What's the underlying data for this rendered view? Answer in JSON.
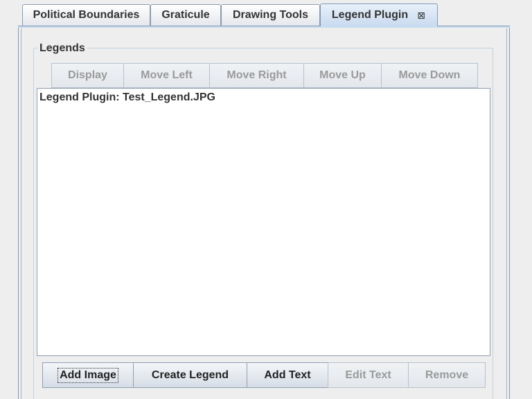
{
  "tabs": [
    {
      "label": "Political Boundaries",
      "active": false
    },
    {
      "label": "Graticule",
      "active": false
    },
    {
      "label": "Drawing Tools",
      "active": false
    },
    {
      "label": "Legend Plugin",
      "active": true,
      "close_icon": "⊠"
    }
  ],
  "legends_group": {
    "title": "Legends",
    "top_buttons": [
      {
        "label": "Display",
        "enabled": false
      },
      {
        "label": "Move Left",
        "enabled": false
      },
      {
        "label": "Move Right",
        "enabled": false
      },
      {
        "label": "Move Up",
        "enabled": false
      },
      {
        "label": "Move Down",
        "enabled": false
      }
    ],
    "list_items": [
      "Legend Plugin: Test_Legend.JPG"
    ],
    "bottom_buttons": [
      {
        "label": "Add Image",
        "enabled": true,
        "focused": true
      },
      {
        "label": "Create Legend",
        "enabled": true
      },
      {
        "label": "Add Text",
        "enabled": true
      },
      {
        "label": "Edit Text",
        "enabled": false
      },
      {
        "label": "Remove",
        "enabled": false
      }
    ]
  }
}
